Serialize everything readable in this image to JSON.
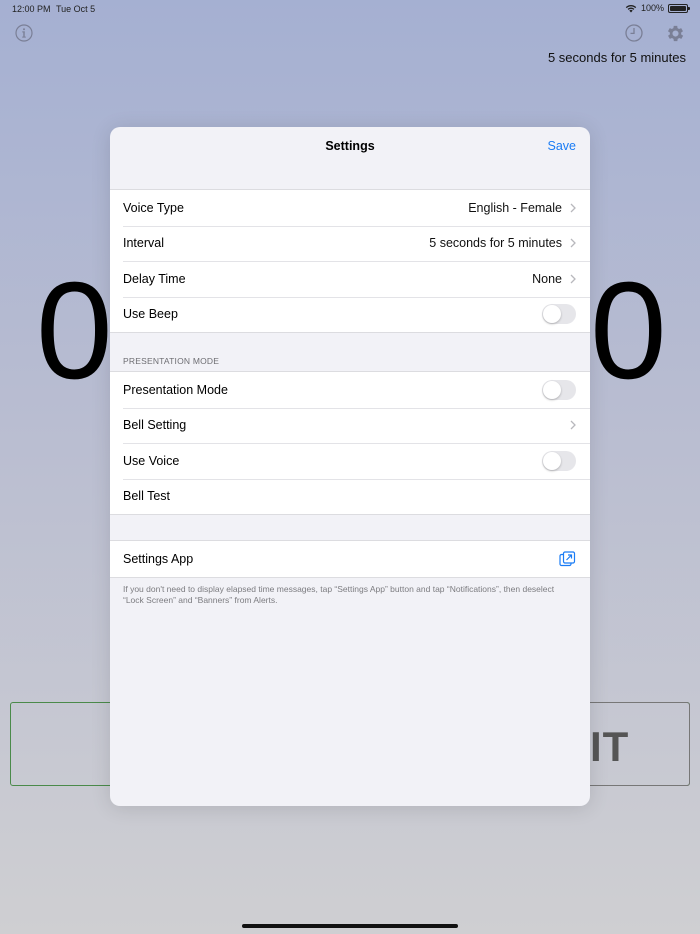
{
  "status_bar": {
    "time": "12:00 PM",
    "date": "Tue Oct 5",
    "battery": "100%"
  },
  "background": {
    "interval_summary": "5 seconds for 5 minutes",
    "digit_left": "0",
    "digit_right": "0",
    "start_label": "IT"
  },
  "modal": {
    "title": "Settings",
    "save_label": "Save",
    "general": [
      {
        "label": "Voice Type",
        "value": "English - Female"
      },
      {
        "label": "Interval",
        "value": "5 seconds for 5 minutes"
      },
      {
        "label": "Delay Time",
        "value": "None"
      },
      {
        "label": "Use Beep"
      }
    ],
    "presentation_header": "PRESENTATION MODE",
    "presentation": [
      {
        "label": "Presentation Mode"
      },
      {
        "label": "Bell Setting"
      },
      {
        "label": "Use Voice"
      },
      {
        "label": "Bell Test"
      }
    ],
    "settings_app_label": "Settings App",
    "footnote": "If you don't need to display elapsed time messages, tap “Settings App” button and tap “Notifications”, then deselect “Lock Screen” and “Banners” from Alerts."
  },
  "colors": {
    "accent": "#1a7cf5",
    "toggle_off": "#e6e6ea"
  },
  "icons": {
    "info": "info-icon",
    "history": "clock-icon",
    "settings": "gear-icon",
    "chevron": "chevron-right-icon",
    "external": "external-link-icon",
    "wifi": "wifi-icon",
    "battery": "battery-icon"
  }
}
